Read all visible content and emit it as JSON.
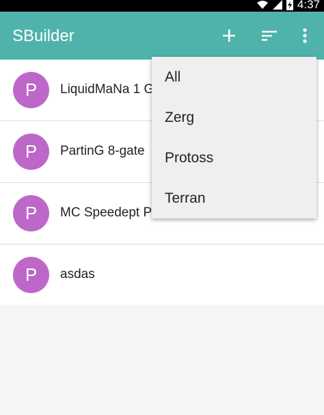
{
  "status_bar": {
    "time": "4:37"
  },
  "app_bar": {
    "title": "SBuilder",
    "accent": "#4fb3ab"
  },
  "list": {
    "avatar_color": "#bd68c9",
    "items": [
      {
        "avatar_letter": "P",
        "title": "LiquidMaNa 1 G"
      },
      {
        "avatar_letter": "P",
        "title": "PartinG 8-gate"
      },
      {
        "avatar_letter": "P",
        "title": "MC Speedept P"
      },
      {
        "avatar_letter": "P",
        "title": "asdas"
      }
    ]
  },
  "menu": {
    "items": [
      {
        "label": "All"
      },
      {
        "label": "Zerg"
      },
      {
        "label": "Protoss"
      },
      {
        "label": "Terran"
      }
    ]
  }
}
